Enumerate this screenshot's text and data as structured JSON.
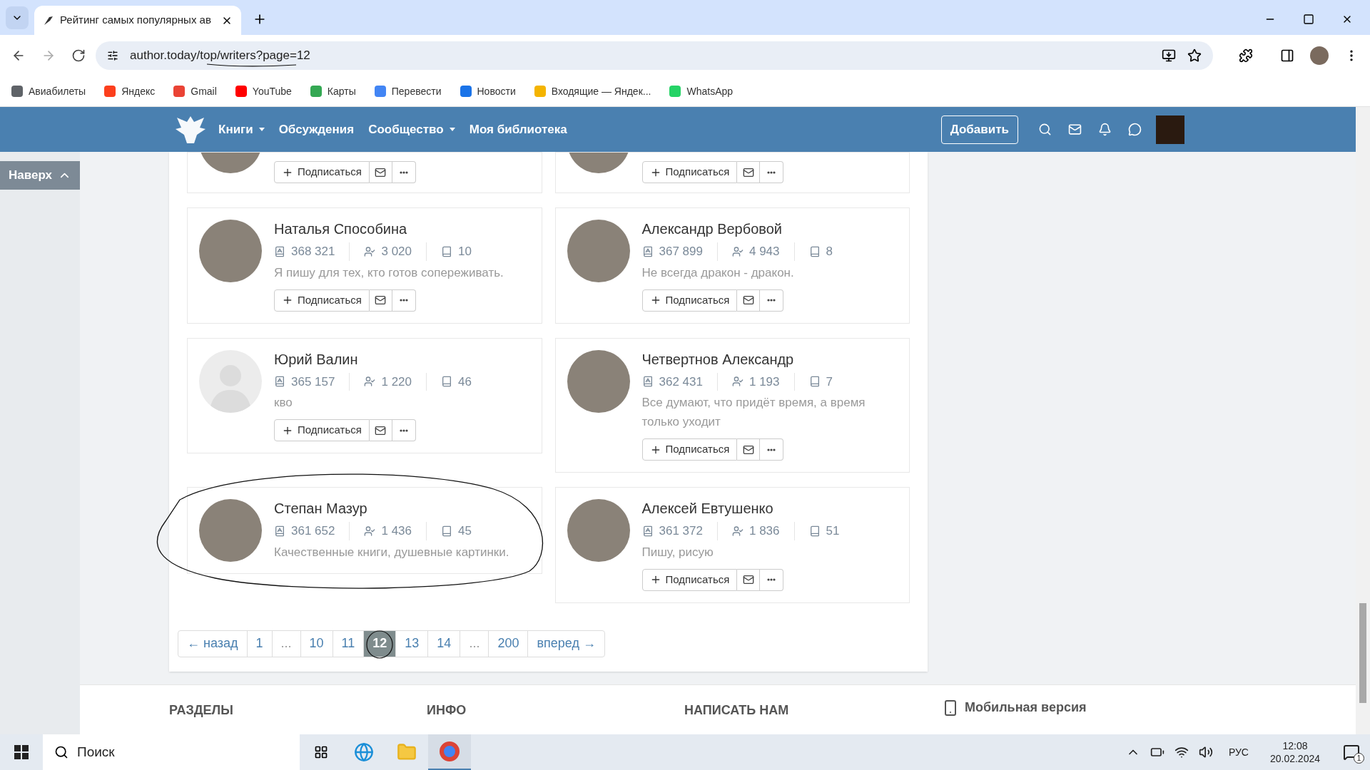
{
  "browser": {
    "tab_title": "Рейтинг самых популярных ав",
    "url": "author.today/top/writers?page=12",
    "bookmarks": [
      {
        "label": "Авиабилеты",
        "color": "#5f6368"
      },
      {
        "label": "Яндекс",
        "color": "#fc3f1d"
      },
      {
        "label": "Gmail",
        "color": "#ea4335"
      },
      {
        "label": "YouTube",
        "color": "#ff0000"
      },
      {
        "label": "Карты",
        "color": "#34a853"
      },
      {
        "label": "Перевести",
        "color": "#4285f4"
      },
      {
        "label": "Новости",
        "color": "#1a73e8"
      },
      {
        "label": "Входящие — Яндек...",
        "color": "#f4b400"
      },
      {
        "label": "WhatsApp",
        "color": "#25d366"
      }
    ]
  },
  "nav": {
    "items": [
      {
        "label": "Книги",
        "dropdown": true
      },
      {
        "label": "Обсуждения",
        "dropdown": false
      },
      {
        "label": "Сообщество",
        "dropdown": true
      },
      {
        "label": "Моя библиотека",
        "dropdown": false
      }
    ],
    "add_button": "Добавить"
  },
  "back_to_top": "Наверх",
  "cards": [
    {
      "kind": "cut",
      "subscribe": "Подписаться"
    },
    {
      "kind": "cut",
      "subscribe": "Подписаться"
    },
    {
      "kind": "photo",
      "name": "Наталья Способина",
      "rating": "368 321",
      "followers": "3 020",
      "books": "10",
      "bio": "Я пишу для тех, кто готов сопереживать.",
      "subscribe": "Подписаться",
      "circled": false
    },
    {
      "kind": "photo",
      "name": "Александр Вербовой",
      "rating": "367 899",
      "followers": "4 943",
      "books": "8",
      "bio": "Не всегда дракон - дракон.",
      "subscribe": "Подписаться",
      "circled": false
    },
    {
      "kind": "silhouette",
      "name": "Юрий Валин",
      "rating": "365 157",
      "followers": "1 220",
      "books": "46",
      "bio": "кво",
      "subscribe": "Подписаться",
      "circled": false
    },
    {
      "kind": "photo",
      "name": "Четвертнов Александр",
      "rating": "362 431",
      "followers": "1 193",
      "books": "7",
      "bio": "Все думают, что придёт время, а время только уходит",
      "subscribe": "Подписаться",
      "circled": false
    },
    {
      "kind": "photo",
      "name": "Степан Мазур",
      "rating": "361 652",
      "followers": "1 436",
      "books": "45",
      "bio": "Качественные книги, душевные картинки.",
      "circled": true
    },
    {
      "kind": "photo",
      "name": "Алексей Евтушенко",
      "rating": "361 372",
      "followers": "1 836",
      "books": "51",
      "bio": "Пишу, рисую",
      "subscribe": "Подписаться",
      "circled": false
    }
  ],
  "pagination": [
    {
      "label": "← назад",
      "kind": "link",
      "selected": false,
      "circled": false
    },
    {
      "label": "1",
      "kind": "link",
      "selected": false,
      "circled": false
    },
    {
      "label": "...",
      "kind": "gap"
    },
    {
      "label": "10",
      "kind": "link",
      "selected": false,
      "circled": false
    },
    {
      "label": "11",
      "kind": "link",
      "selected": false,
      "circled": false
    },
    {
      "label": "12",
      "kind": "link",
      "selected": true,
      "circled": true
    },
    {
      "label": "13",
      "kind": "link",
      "selected": false,
      "circled": false
    },
    {
      "label": "14",
      "kind": "link",
      "selected": false,
      "circled": false
    },
    {
      "label": "...",
      "kind": "gap"
    },
    {
      "label": "200",
      "kind": "link",
      "selected": false,
      "circled": false
    },
    {
      "label": "вперед →",
      "kind": "link",
      "selected": false,
      "circled": false
    }
  ],
  "footer": {
    "columns": [
      "РАЗДЕЛЫ",
      "ИНФО",
      "НАПИСАТЬ НАМ"
    ],
    "mobile": "Мобильная версия"
  },
  "taskbar": {
    "search_placeholder": "Поиск",
    "language": "РУС",
    "time": "12:08",
    "date": "20.02.2024",
    "notification_count": "1"
  }
}
